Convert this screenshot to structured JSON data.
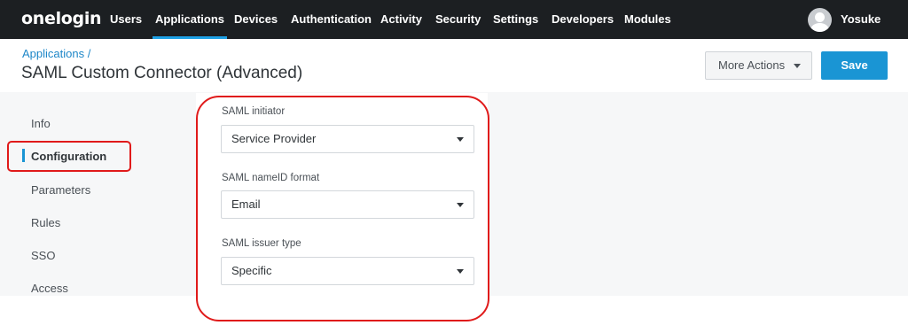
{
  "topnav": {
    "logo": "onelogin",
    "items": [
      {
        "label": "Users",
        "active": false
      },
      {
        "label": "Applications",
        "active": true
      },
      {
        "label": "Devices",
        "active": false
      },
      {
        "label": "Authentication",
        "active": false
      },
      {
        "label": "Activity",
        "active": false
      },
      {
        "label": "Security",
        "active": false
      },
      {
        "label": "Settings",
        "active": false
      },
      {
        "label": "Developers",
        "active": false
      },
      {
        "label": "Modules",
        "active": false
      }
    ],
    "user": {
      "name": "Yosuke",
      "avatar_icon": "user-avatar-icon"
    }
  },
  "header": {
    "breadcrumb": "Applications /",
    "title": "SAML Custom Connector (Advanced)",
    "more_actions_label": "More Actions",
    "save_label": "Save"
  },
  "sidebar": {
    "items": [
      {
        "label": "Info",
        "active": false
      },
      {
        "label": "Configuration",
        "active": true
      },
      {
        "label": "Parameters",
        "active": false
      },
      {
        "label": "Rules",
        "active": false
      },
      {
        "label": "SSO",
        "active": false
      },
      {
        "label": "Access",
        "active": false
      }
    ]
  },
  "form": {
    "fields": [
      {
        "label": "SAML initiator",
        "value": "Service Provider"
      },
      {
        "label": "SAML nameID format",
        "value": "Email"
      },
      {
        "label": "SAML issuer type",
        "value": "Specific"
      }
    ]
  },
  "colors": {
    "nav_background": "#1c1f22",
    "accent": "#1a95d4",
    "annotation": "#e01a1a"
  }
}
